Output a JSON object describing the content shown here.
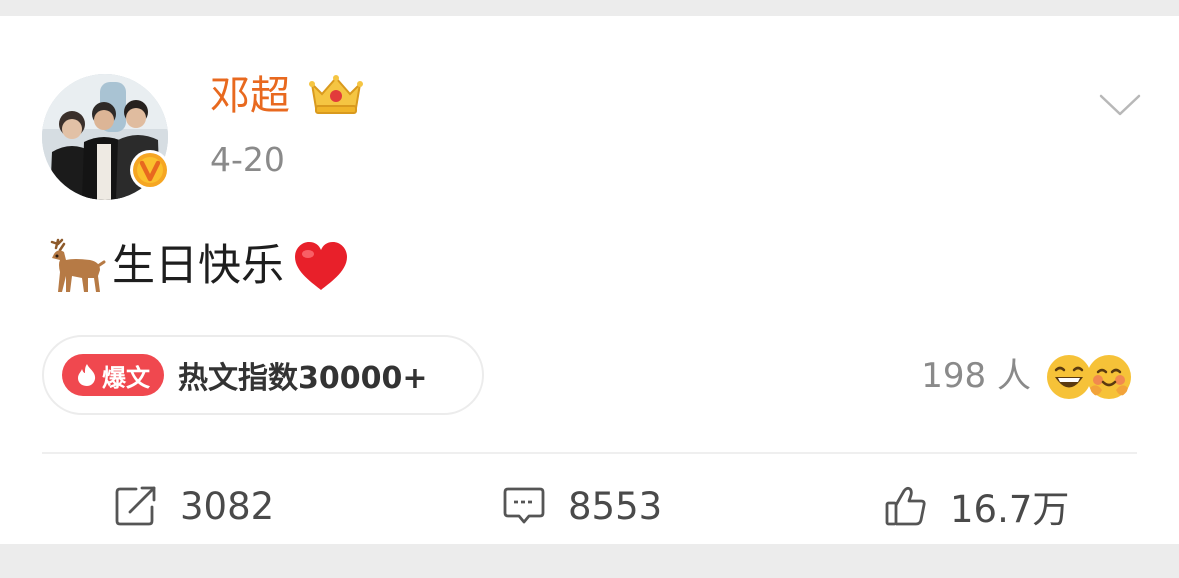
{
  "post": {
    "author": "邓超",
    "date": "4-20",
    "text": "生日快乐",
    "hot_badge": "爆文",
    "hot_label": "热文指数30000+",
    "reactor_count": "198 人"
  },
  "actions": {
    "repost_count": "3082",
    "comment_count": "8553",
    "like_count": "16.7万"
  },
  "icons": {
    "avatar": "avatar",
    "verified": "verified-badge-icon",
    "crown": "crown-icon",
    "more": "chevron-down-icon",
    "deer": "deer-emoji-icon",
    "heart": "heart-emoji-icon",
    "repost": "repost-icon",
    "comment": "comment-icon",
    "like": "thumbs-up-icon"
  },
  "colors": {
    "author": "#e8691f",
    "hot_badge": "#f0484f",
    "muted": "#8a8a8a",
    "text": "#1e1e1e"
  }
}
